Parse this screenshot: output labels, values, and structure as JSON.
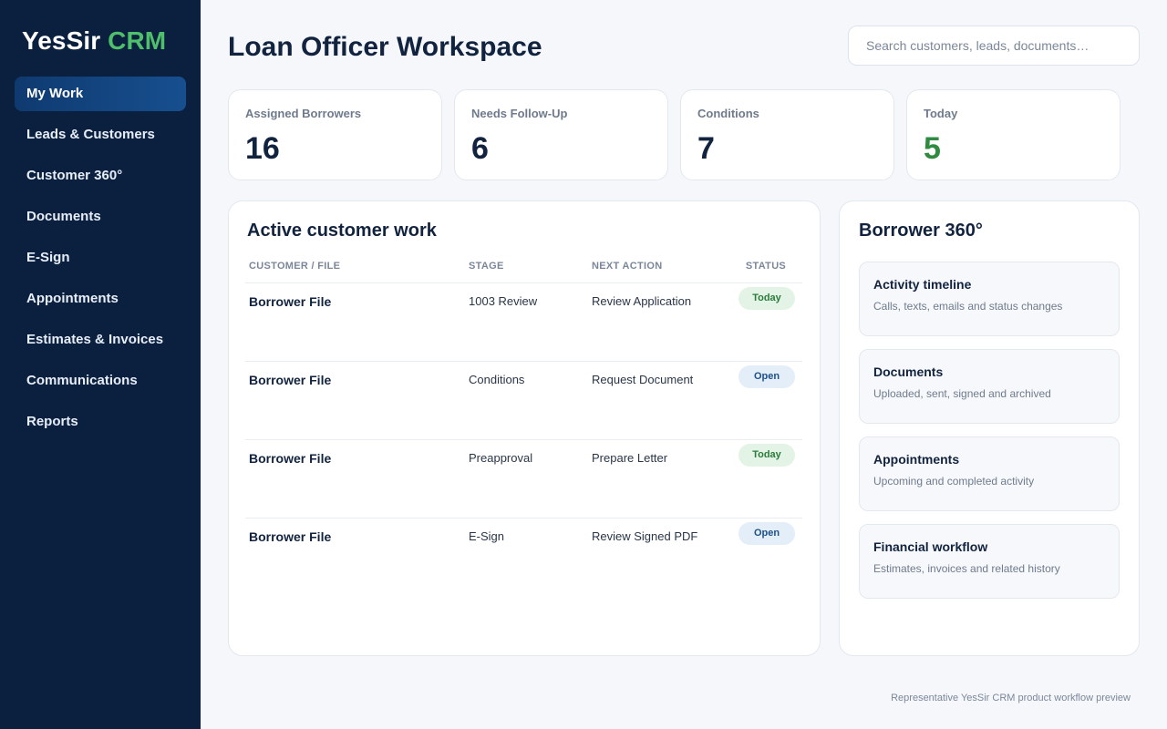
{
  "brand": {
    "name": "YesSir",
    "accent": "CRM"
  },
  "sidebar": {
    "items": [
      {
        "label": "My Work",
        "active": true
      },
      {
        "label": "Leads & Customers"
      },
      {
        "label": "Customer 360°"
      },
      {
        "label": "Documents"
      },
      {
        "label": "E-Sign"
      },
      {
        "label": "Appointments"
      },
      {
        "label": "Estimates & Invoices"
      },
      {
        "label": "Communications"
      },
      {
        "label": "Reports"
      }
    ]
  },
  "header": {
    "title": "Loan Officer Workspace",
    "search_placeholder": "Search customers, leads, documents…"
  },
  "stats": [
    {
      "label": "Assigned Borrowers",
      "value": "16"
    },
    {
      "label": "Needs Follow-Up",
      "value": "6"
    },
    {
      "label": "Conditions",
      "value": "7"
    },
    {
      "label": "Today",
      "value": "5"
    }
  ],
  "work": {
    "title": "Active customer work",
    "columns": [
      "CUSTOMER / FILE",
      "STAGE",
      "NEXT ACTION",
      "STATUS"
    ],
    "rows": [
      {
        "customer": "Borrower File",
        "stage": "1003 Review",
        "next_action": "Review Application",
        "status": "Today"
      },
      {
        "customer": "Borrower File",
        "stage": "Conditions",
        "next_action": "Request Document",
        "status": "Open"
      },
      {
        "customer": "Borrower File",
        "stage": "Preapproval",
        "next_action": "Prepare Letter",
        "status": "Today"
      },
      {
        "customer": "Borrower File",
        "stage": "E-Sign",
        "next_action": "Review Signed PDF",
        "status": "Open"
      }
    ]
  },
  "borrower360": {
    "title": "Borrower 360°",
    "cards": [
      {
        "title": "Activity timeline",
        "desc": "Calls, texts, emails and status changes"
      },
      {
        "title": "Documents",
        "desc": "Uploaded, sent, signed and archived"
      },
      {
        "title": "Appointments",
        "desc": "Upcoming and completed activity"
      },
      {
        "title": "Financial workflow",
        "desc": "Estimates, invoices and related history"
      }
    ]
  },
  "footer": {
    "note": "Representative YesSir CRM product workflow preview"
  },
  "colors": {
    "sidebar_bg": "#0b1f3f",
    "brand_accent": "#4fbf6b",
    "active_nav": "#174f8f",
    "today_badge": "#e3f4e6",
    "open_badge": "#e4eef9",
    "highlight_stat": "#2e8b3f"
  }
}
